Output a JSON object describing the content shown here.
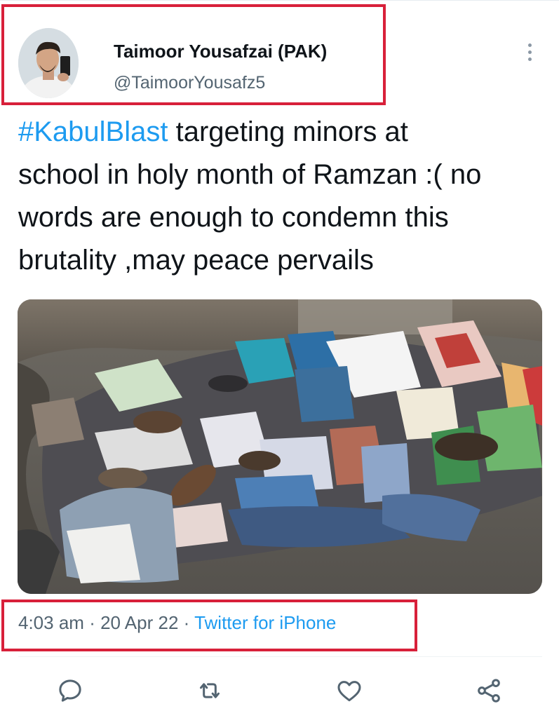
{
  "tweet": {
    "author_name": "Taimoor Yousafzai (PAK)",
    "author_handle": "@TaimoorYousafz5",
    "hashtag": "#KabulBlast",
    "text_line1_rest": " targeting minors at",
    "text_line2": "school in holy month of Ramzan :(  no",
    "text_line3": "words are enough to condemn this",
    "text_line4": "brutality ,may peace pervails",
    "time": "4:03 am",
    "date": "20 Apr 22",
    "separator": "·",
    "source": "Twitter for iPhone"
  },
  "icons": {
    "more": "more-vertical-icon",
    "reply": "reply-icon",
    "retweet": "retweet-icon",
    "like": "heart-icon",
    "share": "share-icon"
  },
  "colors": {
    "accent": "#1d9bf0",
    "highlight_box": "#d8203a",
    "secondary_text": "#536471"
  }
}
